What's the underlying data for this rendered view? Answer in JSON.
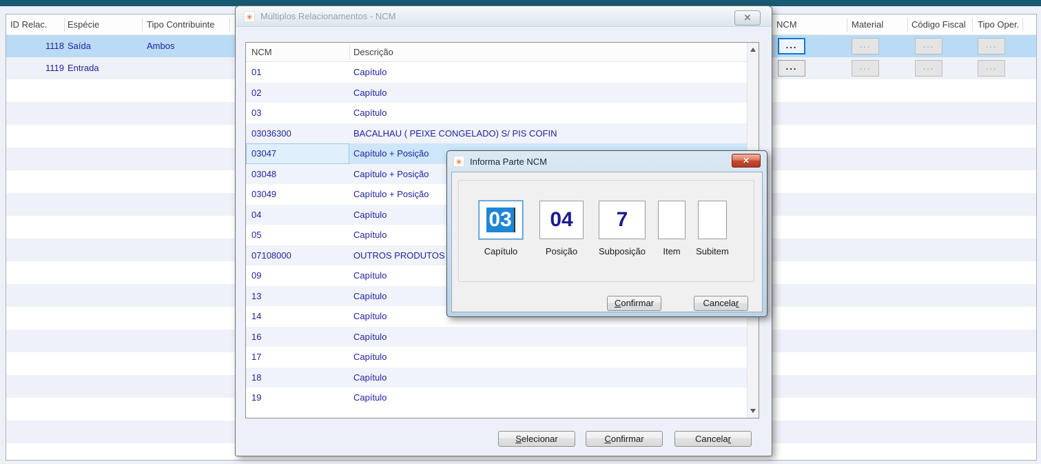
{
  "colors": {
    "top_bar": "#175a73",
    "selected_row": "#b9dbf5",
    "row_alt": "#eef1f8",
    "navy_text": "#22229a",
    "field_selection_blue": "#1e87d5",
    "focus_border_blue": "#1177d1"
  },
  "background_table": {
    "headers": {
      "id_relac": "ID Relac.",
      "especie": "Espécie",
      "tipo_contribuinte": "Tipo Contribuinte",
      "ncm": "NCM",
      "material": "Material",
      "codigo_fiscal": "Código Fiscal",
      "tipo_oper": "Tipo Oper."
    },
    "rows": [
      {
        "id": "1118",
        "especie": "Saída",
        "tipo_contribuinte": "Ambos"
      },
      {
        "id": "1119",
        "especie": "Entrada",
        "tipo_contribuinte": ""
      }
    ],
    "ellipsis": "..."
  },
  "ncm_dialog": {
    "icon_glyph": "✳",
    "title": "Múltiplos Relacionamentos - NCM",
    "close_glyph": "✕",
    "columns": {
      "ncm": "NCM",
      "descricao": "Descrição"
    },
    "rows": [
      [
        "01",
        "Capítulo"
      ],
      [
        "02",
        "Capítulo"
      ],
      [
        "03",
        "Capítulo"
      ],
      [
        "03036300",
        "BACALHAU ( PEIXE CONGELADO) S/ PIS COFIN"
      ],
      [
        "03047",
        "Capítulo + Posição"
      ],
      [
        "03048",
        "Capítulo + Posição"
      ],
      [
        "03049",
        "Capítulo + Posição"
      ],
      [
        "04",
        "Capítulo"
      ],
      [
        "05",
        "Capítulo"
      ],
      [
        "07108000",
        "OUTROS PRODUTOS"
      ],
      [
        "09",
        "Capítulo"
      ],
      [
        "13",
        "Capítulo"
      ],
      [
        "14",
        "Capítulo"
      ],
      [
        "16",
        "Capítulo"
      ],
      [
        "17",
        "Capítulo"
      ],
      [
        "18",
        "Capítulo"
      ],
      [
        "19",
        "Capítulo"
      ]
    ],
    "selected_row": "03047",
    "buttons": {
      "selecionar": {
        "pre": "",
        "key": "S",
        "post": "elecionar"
      },
      "confirmar": {
        "pre": "",
        "key": "C",
        "post": "onfirmar"
      },
      "cancelar": {
        "pre": "Cancela",
        "key": "r",
        "post": ""
      }
    }
  },
  "parte_dialog": {
    "icon_glyph": "✳",
    "title": "Informa Parte NCM",
    "close_glyph": "✕",
    "fields": {
      "capitulo": {
        "label": "Capítulo",
        "value": "03"
      },
      "posicao": {
        "label": "Posição",
        "value": "04"
      },
      "subposicao": {
        "label": "Subposição",
        "value": "7"
      },
      "item": {
        "label": "Item",
        "value": ""
      },
      "subitem": {
        "label": "Subitem",
        "value": ""
      }
    },
    "buttons": {
      "confirmar": {
        "pre": "",
        "key": "C",
        "post": "onfirmar"
      },
      "cancelar": {
        "pre": "Cancela",
        "key": "r",
        "post": ""
      }
    }
  }
}
